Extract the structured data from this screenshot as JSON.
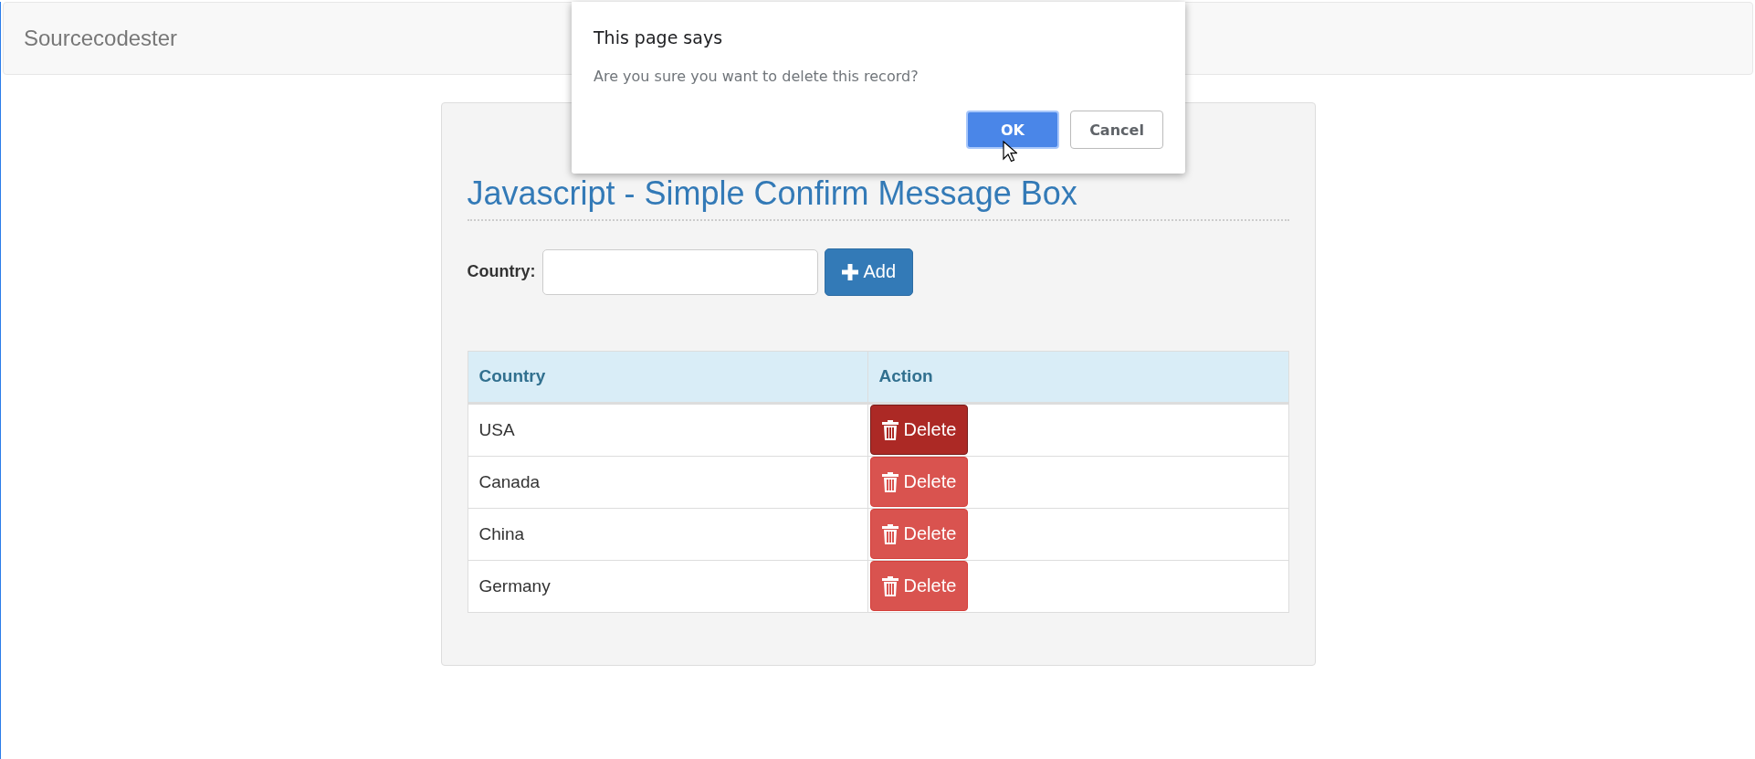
{
  "navbar": {
    "brand": "Sourcecodester"
  },
  "panel": {
    "title": "Javascript - Simple Confirm Message Box",
    "form": {
      "label": "Country:",
      "button": "Add"
    },
    "table": {
      "columns": [
        "Country",
        "Action"
      ],
      "rows": [
        {
          "country": "USA",
          "action": "Delete",
          "pressed": true
        },
        {
          "country": "Canada",
          "action": "Delete",
          "pressed": false
        },
        {
          "country": "China",
          "action": "Delete",
          "pressed": false
        },
        {
          "country": "Germany",
          "action": "Delete",
          "pressed": false
        }
      ]
    }
  },
  "dialog": {
    "title": "This page says",
    "message": "Are you sure you want to delete this record?",
    "buttons": [
      {
        "label": "OK",
        "kind": "primary"
      },
      {
        "label": "Cancel",
        "kind": "secondary"
      }
    ]
  }
}
